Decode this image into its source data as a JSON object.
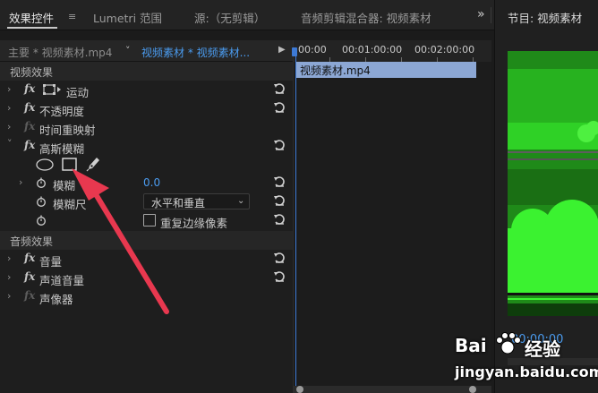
{
  "tabs": {
    "effect_controls": "效果控件",
    "menu_glyph": "≡",
    "lumetri": "Lumetri 范围",
    "source": "源:（无剪辑）",
    "audio_mixer": "音频剪辑混合器: 视频素材",
    "overflow": "»"
  },
  "program": {
    "title": "节目: 视频素材",
    "timecode": "00:00:00"
  },
  "clip_header": {
    "master": "主要 * 视频素材.mp4",
    "clip": "视频素材 * 视频素材...",
    "chevron": "˅",
    "play": "▶"
  },
  "timeline": {
    "ruler": [
      "00:00",
      "00:01:00:00",
      "00:02:00:00"
    ],
    "clip_name": "视频素材.mp4"
  },
  "sections": {
    "video": "视频效果",
    "audio": "音频效果"
  },
  "video_effects": [
    {
      "label": "运动"
    },
    {
      "label": "不透明度"
    },
    {
      "label": "时间重映射"
    },
    {
      "label": "高斯模糊"
    }
  ],
  "gaussian": {
    "blurriness_label": "模糊",
    "blurriness_value": "0.0",
    "dimension_label": "模糊尺",
    "dimension_value": "水平和垂直",
    "repeat_edge_label": "重复边缘像素"
  },
  "audio_effects": [
    {
      "label": "音量"
    },
    {
      "label": "声道音量"
    },
    {
      "label": "声像器"
    }
  ],
  "glyphs": {
    "fx": "fx",
    "arrow_right": "›",
    "arrow_down": "˅",
    "dd": "⌄"
  },
  "watermark": {
    "brand": "Bai",
    "brand2": "经验",
    "url": "jingyan.baidu.com"
  },
  "colors": {
    "accent": "#4b9cf0",
    "clip": "#8ca7d4",
    "arrow": "#e8384f",
    "video_green": "#22c41a"
  }
}
